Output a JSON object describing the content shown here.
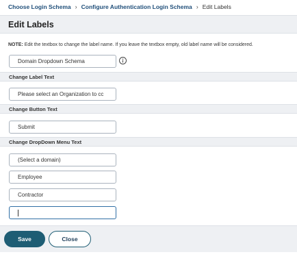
{
  "breadcrumb": {
    "items": [
      "Choose Login Schema",
      "Configure Authentication Login Schema"
    ],
    "current": "Edit Labels"
  },
  "header": {
    "title": "Edit Labels"
  },
  "note": {
    "prefix": "NOTE:",
    "text": " Edit the textbox to change the label name. If you leave the textbox empty, old label name will be considered."
  },
  "schema_field": {
    "value": "Domain Dropdown Schema"
  },
  "sections": {
    "label_text": "Change Label Text",
    "button_text": "Change Button Text",
    "dropdown_text": "Change DropDown Menu Text"
  },
  "label_field": {
    "value": "Please select an Organization to cc"
  },
  "button_field": {
    "value": "Submit"
  },
  "dropdown_fields": [
    "(Select a domain)",
    "Employee",
    "Contractor",
    ""
  ],
  "footer": {
    "save_label": "Save",
    "close_label": "Close"
  },
  "icons": {
    "info": "info-icon"
  }
}
